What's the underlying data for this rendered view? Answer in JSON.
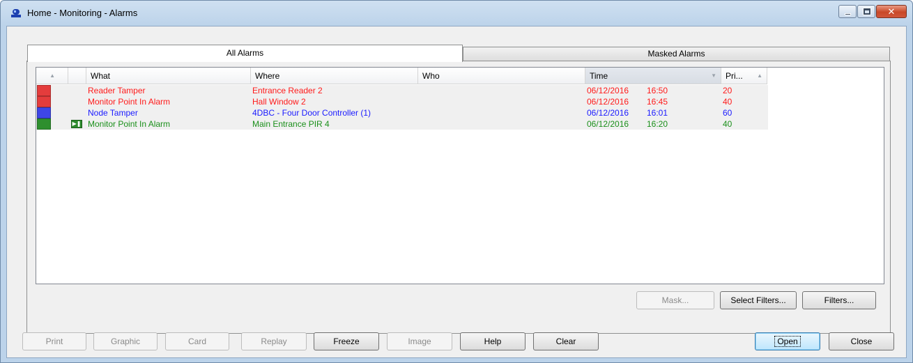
{
  "window": {
    "title": "Home - Monitoring - Alarms"
  },
  "tabs": [
    {
      "label": "All Alarms",
      "active": true
    },
    {
      "label": "Masked Alarms",
      "active": false
    }
  ],
  "grid": {
    "columns": {
      "what": "What",
      "where": "Where",
      "who": "Who",
      "time": "Time",
      "priority": "Pri..."
    },
    "rows": [
      {
        "color": "#e43c3c",
        "text_color": "#ff1a1a",
        "has_video": false,
        "what": "Reader Tamper",
        "where": "Entrance Reader 2",
        "who": "",
        "date": "06/12/2016",
        "time": "16:50",
        "priority": "20"
      },
      {
        "color": "#e43c3c",
        "text_color": "#ff1a1a",
        "has_video": false,
        "what": "Monitor Point In Alarm",
        "where": "Hall Window 2",
        "who": "",
        "date": "06/12/2016",
        "time": "16:45",
        "priority": "40"
      },
      {
        "color": "#3e46e6",
        "text_color": "#1a1aff",
        "has_video": false,
        "what": "Node Tamper",
        "where": "4DBC - Four Door Controller (1)",
        "who": "",
        "date": "06/12/2016",
        "time": "16:01",
        "priority": "60"
      },
      {
        "color": "#2e8f2e",
        "text_color": "#1a8f1a",
        "has_video": true,
        "what": "Monitor Point In Alarm",
        "where": "Main Entrance PIR 4",
        "who": "",
        "date": "06/12/2016",
        "time": "16:20",
        "priority": "40"
      }
    ]
  },
  "panel_buttons": {
    "mask": "Mask...",
    "select_filters": "Select Filters...",
    "filters": "Filters..."
  },
  "bottom_buttons": {
    "print": "Print",
    "graphic": "Graphic",
    "card": "Card",
    "replay": "Replay",
    "freeze": "Freeze",
    "image": "Image",
    "help": "Help",
    "clear": "Clear",
    "open": "Open",
    "close": "Close"
  },
  "icons": {
    "app": "alarm-bell-icon",
    "video": "video-play-icon",
    "minimize": "minimize-icon",
    "maximize": "maximize-icon",
    "close": "close-icon"
  }
}
